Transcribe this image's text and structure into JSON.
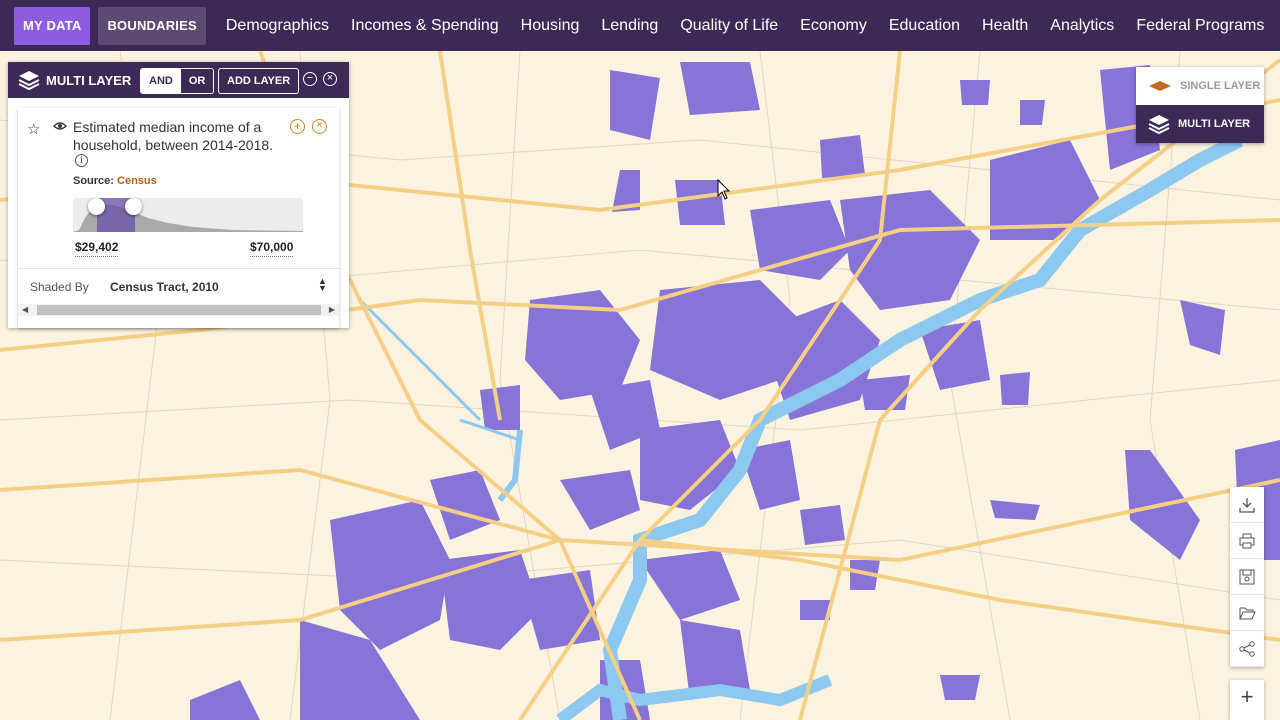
{
  "nav": {
    "my_data": "MY DATA",
    "boundaries": "BOUNDARIES",
    "links": [
      "Demographics",
      "Incomes & Spending",
      "Housing",
      "Lending",
      "Quality of Life",
      "Economy",
      "Education",
      "Health",
      "Analytics",
      "Federal Programs"
    ]
  },
  "panel": {
    "title": "MULTI LAYER",
    "and_label": "AND",
    "or_label": "OR",
    "add_layer": "ADD LAYER",
    "layer": {
      "description": "Estimated median income of a household, between 2014-2018.",
      "source_label": "Source:",
      "source_value": "Census",
      "range_min": "$29,402",
      "range_max": "$70,000",
      "shaded_by_label": "Shaded By",
      "shaded_by_value": "Census Tract, 2010"
    }
  },
  "mode": {
    "single": "SINGLE LAYER",
    "multi": "MULTI LAYER"
  },
  "colors": {
    "nav_bg": "#3c2955",
    "accent": "#8e5cde",
    "tract_fill": "#8873d6",
    "water": "#8cc8f0",
    "roads": "#f5cf86",
    "map_bg": "#fbf3e0"
  },
  "tools": [
    "download-icon",
    "print-icon",
    "save-icon",
    "folder-open-icon",
    "share-icon",
    "zoom-in-icon"
  ]
}
